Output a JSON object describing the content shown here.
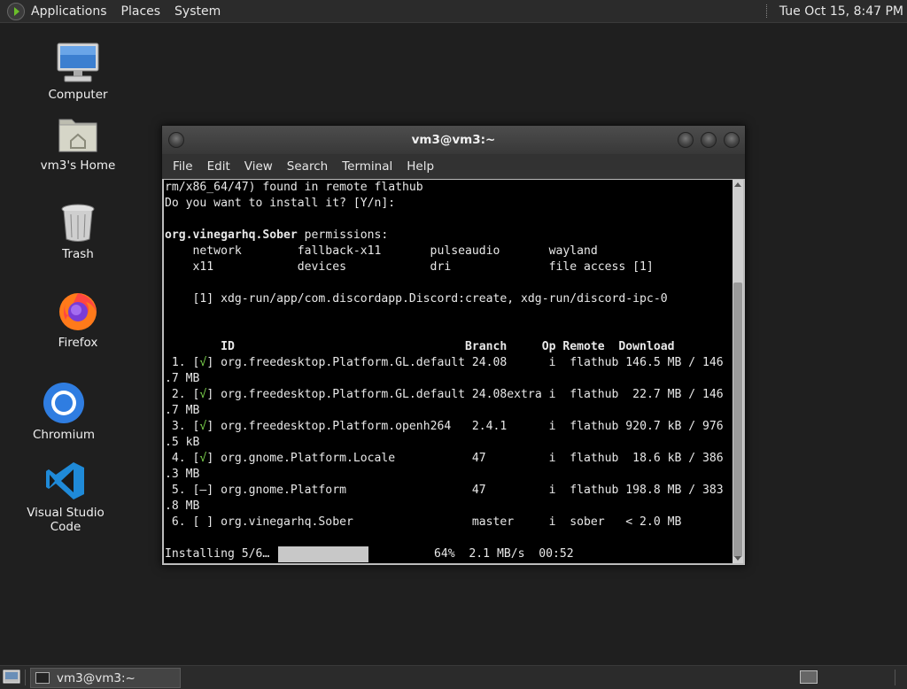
{
  "top_panel": {
    "applications": "Applications",
    "places": "Places",
    "system": "System",
    "clock": "Tue Oct 15,  8:47 PM"
  },
  "desktop_icons": {
    "computer": "Computer",
    "home": "vm3's Home",
    "trash": "Trash",
    "firefox": "Firefox",
    "chromium": "Chromium",
    "vscode": "Visual Studio Code"
  },
  "terminal": {
    "title": "vm3@vm3:~",
    "menu": {
      "file": "File",
      "edit": "Edit",
      "view": "View",
      "search": "Search",
      "terminal": "Terminal",
      "help": "Help"
    },
    "lines": {
      "l1": "rm/x86_64/47) found in remote flathub",
      "l2": "Do you want to install it? [Y/n]:",
      "l3_app": "org.vinegarhq.Sober",
      "l3_rest": " permissions:",
      "l4": "    network        fallback-x11       pulseaudio       wayland",
      "l5": "    x11            devices            dri              file access [1]",
      "l6": "    [1] xdg-run/app/com.discordapp.Discord:create, xdg-run/discord-ipc-0",
      "header": "        ID                                 Branch     Op Remote  Download",
      "r1a": " 1. [",
      "r1c": "√",
      "r1b": "] org.freedesktop.Platform.GL.default 24.08      i  flathub 146.5 MB / 146",
      "r1w": ".7 MB",
      "r2a": " 2. [",
      "r2c": "√",
      "r2b": "] org.freedesktop.Platform.GL.default 24.08extra i  flathub  22.7 MB / 146",
      "r2w": ".7 MB",
      "r3a": " 3. [",
      "r3c": "√",
      "r3b": "] org.freedesktop.Platform.openh264   2.4.1      i  flathub 920.7 kB / 976",
      "r3w": ".5 kB",
      "r4a": " 4. [",
      "r4c": "√",
      "r4b": "] org.gnome.Platform.Locale           47         i  flathub  18.6 kB / 386",
      "r4w": ".3 MB",
      "r5": " 5. [—] org.gnome.Platform                  47         i  flathub 198.8 MB / 383",
      "r5w": ".8 MB",
      "r6": " 6. [ ] org.vinegarhq.Sober                 master     i  sober   < 2.0 MB",
      "status_left": "Installing 5/6…",
      "status_right": "64%  2.1 MB/s  00:52"
    },
    "progress_fraction": 0.64
  },
  "taskbar": {
    "task_label": "vm3@vm3:~"
  }
}
